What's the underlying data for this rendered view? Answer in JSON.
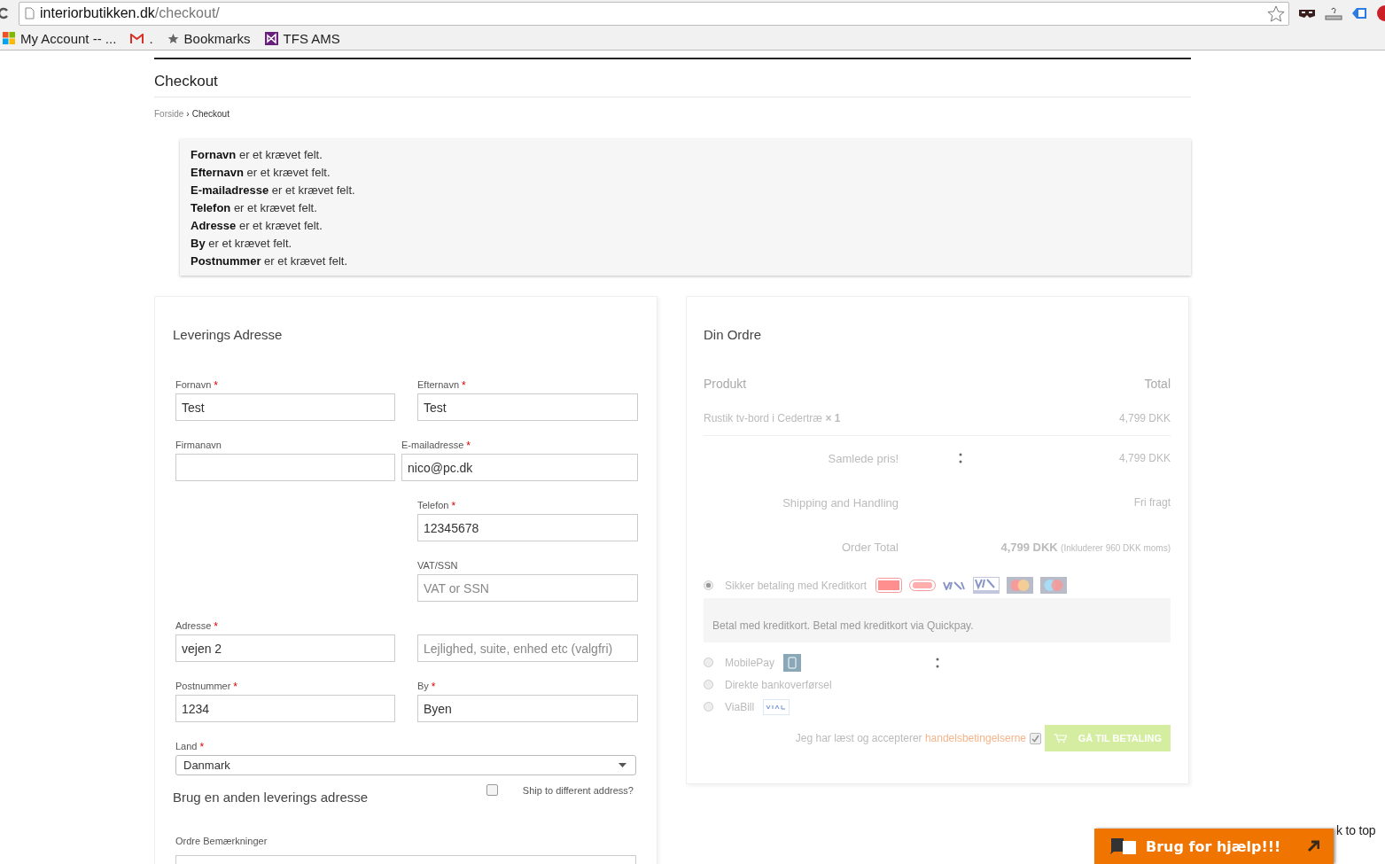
{
  "browser": {
    "url_host": "interiorbutikken.dk",
    "url_path": "/checkout/",
    "bookmarks": [
      {
        "kind": "windows",
        "label": "My Account -- ..."
      },
      {
        "kind": "gmail",
        "label": "."
      },
      {
        "kind": "star",
        "label": "Bookmarks"
      },
      {
        "kind": "vs",
        "label": "TFS AMS"
      }
    ]
  },
  "page": {
    "title": "Checkout",
    "breadcrumb": [
      {
        "kind": "link",
        "label": "Forside"
      },
      {
        "kind": "separator",
        "label": "›"
      },
      {
        "kind": "current",
        "label": "Checkout"
      }
    ]
  },
  "errors": [
    "**Fornavn** er et krævet felt.",
    "**Efternavn** er et krævet felt.",
    "**E-mailadresse** er et krævet felt.",
    "**Telefon** er et krævet felt.",
    "**Adresse** er et krævet felt.",
    "**By** er et krævet felt.",
    "**Postnummer** er et krævet felt."
  ],
  "delivery": {
    "title": "Leverings Adresse",
    "rows": [
      {
        "left": {
          "label": "Fornavn",
          "required_mark": "*",
          "value": "Test"
        },
        "right": {
          "label": "Efternavn",
          "required_mark": "*",
          "value": "Test"
        }
      },
      {
        "left": {
          "label": "Firmanavn"
        },
        "right": {
          "label": "E-mailadresse",
          "required_mark": "*",
          "value": "nico@pc.dk"
        }
      },
      {
        "right": {
          "label": "Telefon",
          "required_mark": "*",
          "value": "12345678"
        }
      },
      {
        "right": {
          "label": "VAT/SSN",
          "placeholder": "VAT or SSN"
        }
      },
      {
        "left": {
          "label": "Adresse",
          "required_mark": "*",
          "value": "vejen 2"
        },
        "right": {
          "placeholder": "Lejlighed, suite, enhed etc (valgfri)"
        }
      },
      {
        "left": {
          "label": "Postnummer",
          "required_mark": "*",
          "value": "1234"
        },
        "right": {
          "label": "By",
          "required_mark": "*",
          "value": "Byen"
        }
      }
    ],
    "country": {
      "label": "Land",
      "required_mark": "*",
      "value": "Danmark"
    },
    "other_address": {
      "title": "Brug en anden leverings adresse",
      "checkbox_label": "Ship to different address?",
      "checked": false
    },
    "notes": {
      "label": "Ordre Bemærkninger"
    }
  },
  "order": {
    "title": "Din Ordre",
    "columns": [
      "Produkt",
      "Total"
    ],
    "items": [
      {
        "name": "Rustik tv-bord i Cedertræ",
        "qty": "× 1",
        "total": "4,799 DKK"
      }
    ],
    "totals": [
      {
        "label": "Samlede pris!",
        "value": "4,799 DKK"
      },
      {
        "label": "Shipping and Handling",
        "value": "Fri fragt"
      },
      {
        "label": "Order Total",
        "value": "4,799 DKK",
        "note": "(Inkluderer 960 DKK moms)"
      }
    ],
    "payment_methods": [
      {
        "kind": "card",
        "label": "Sikker betaling med Kreditkort",
        "selected": true,
        "description": "Betal med kreditkort. Betal med kreditkort via Quickpay."
      },
      {
        "kind": "mobilepay",
        "label": "MobilePay",
        "selected": false
      },
      {
        "kind": "bank",
        "label": "Direkte bankoverførsel",
        "selected": false
      },
      {
        "kind": "viabill",
        "label": "ViaBill",
        "selected": false
      }
    ],
    "terms": {
      "text": "Jeg har læst og accepterer",
      "link": "handelsbetingelserne",
      "checked": true
    },
    "submit": "GÅ TIL BETALING"
  },
  "help": {
    "label": "Brug for hjælp!!!"
  },
  "back_to_top": "k to top"
}
